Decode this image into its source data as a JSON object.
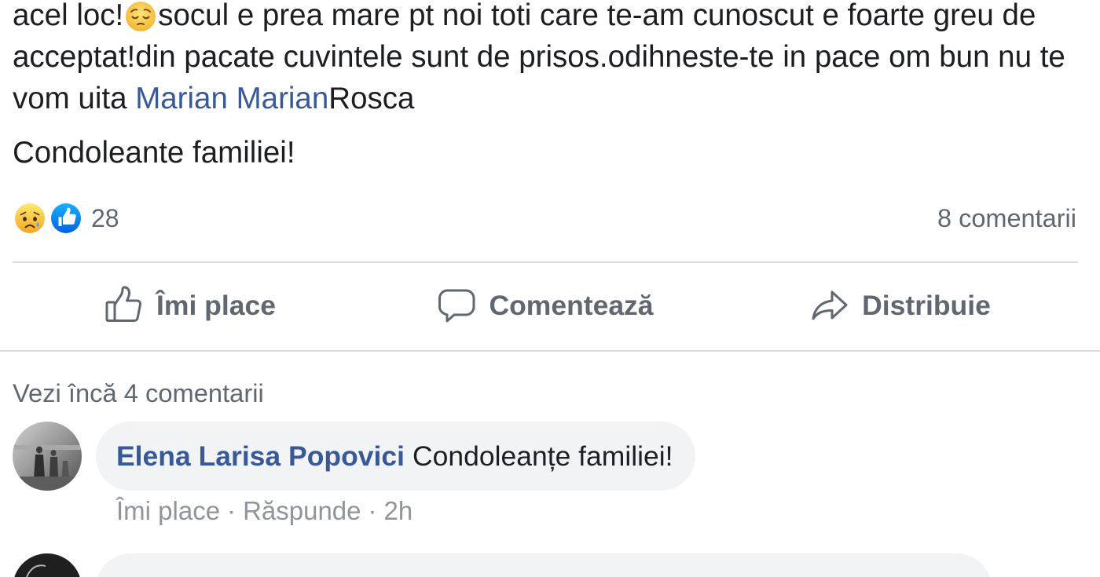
{
  "post": {
    "lines": [
      {
        "before": "acel loc!",
        "emoji": "pensive-face-icon",
        "after": "socul e prea mare pt noi toti care te-am cunoscut e foarte greu de"
      },
      {
        "text": "acceptat!din pacate cuvintele sunt de prisos.odihneste-te in pace om bun nu te"
      },
      {
        "before": "vom uita ",
        "mention": "Marian Marian",
        "after": "Rosca"
      }
    ],
    "closing": "Condoleante familiei!"
  },
  "reactions": {
    "icons": [
      "sad-reaction-icon",
      "like-reaction-icon"
    ],
    "count": "28",
    "comments_count": "8 comentarii"
  },
  "actions": [
    {
      "label": "Îmi place",
      "icon": "thumbs-up-icon"
    },
    {
      "label": "Comentează",
      "icon": "comment-icon"
    },
    {
      "label": "Distribuie",
      "icon": "share-icon"
    }
  ],
  "comments": {
    "view_more": "Vezi încă 4 comentarii",
    "items": [
      {
        "author": "Elena Larisa Popovici",
        "text": "Condoleanțe familiei!",
        "like": "Îmi place",
        "reply": "Răspunde",
        "time": "2h",
        "separator": "·"
      }
    ]
  },
  "colors": {
    "text": "#1c1e21",
    "link": "#385898",
    "secondary": "#606770",
    "meta": "#90949c",
    "bubble": "#f2f3f5",
    "divider": "#dadde1"
  }
}
